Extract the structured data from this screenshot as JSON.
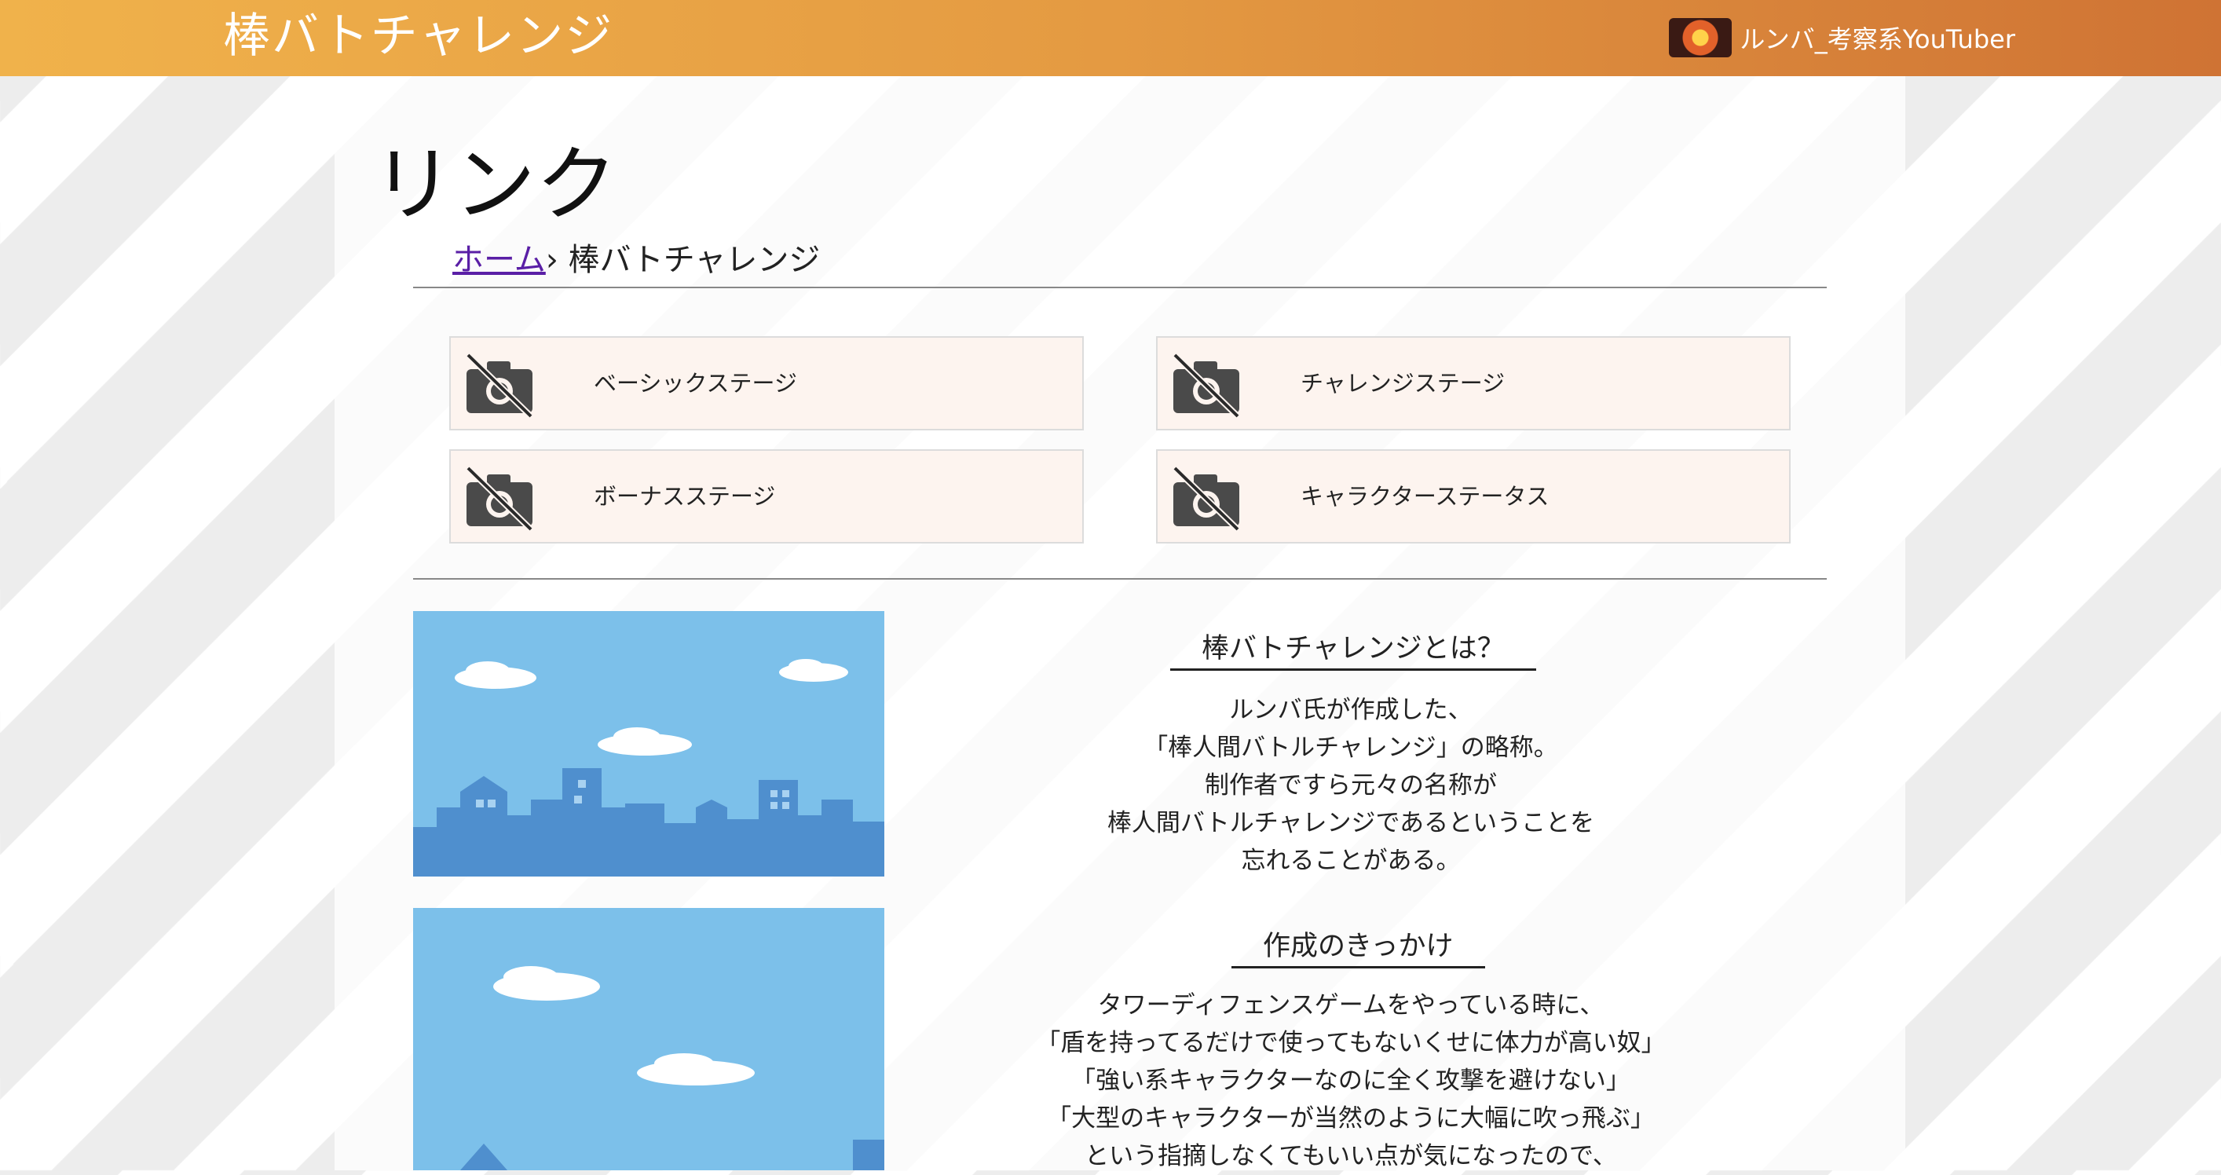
{
  "header": {
    "site_title": "棒バトチャレンジ",
    "user_name": "ルンバ_考察系YouTuber"
  },
  "page": {
    "title": "リンク",
    "breadcrumb_home": "ホーム",
    "breadcrumb_separator": "›",
    "breadcrumb_current": "棒バトチャレンジ"
  },
  "links": [
    {
      "label": "ベーシックステージ",
      "icon": "no-image-camera-icon"
    },
    {
      "label": "チャレンジステージ",
      "icon": "no-image-camera-icon"
    },
    {
      "label": "ボーナスステージ",
      "icon": "no-image-camera-icon"
    },
    {
      "label": "キャラクターステータス",
      "icon": "no-image-camera-icon"
    }
  ],
  "sections": [
    {
      "title": "棒バトチャレンジとは？",
      "lines": [
        "ルンバ氏が作成した、",
        "「棒人間バトルチャレンジ」の略称。",
        "制作者ですら元々の名称が",
        "棒人間バトルチャレンジであるということを",
        "忘れることがある。"
      ]
    },
    {
      "title": "作成のきっかけ",
      "lines": [
        "タワーディフェンスゲームをやっている時に、",
        "「盾を持ってるだけで使ってもないくせに体力が高い奴」",
        "「強い系キャラクターなのに全く攻撃を避けない」",
        "「大型のキャラクターが当然のように大幅に吹っ飛ぶ」",
        "という指摘しなくてもいい点が気になったので、"
      ]
    }
  ],
  "colors": {
    "header_start": "#f0b24b",
    "header_end": "#cf7334",
    "card_bg": "#fdf4ef",
    "sky": "#7cc0ea",
    "city": "#4f8fce",
    "link": "#5a1fa6"
  }
}
